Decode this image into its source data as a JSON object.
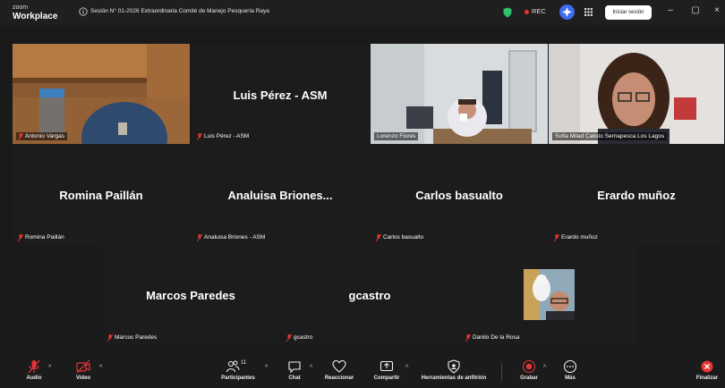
{
  "app": {
    "logo_line1": "zoom",
    "logo_line2": "Workplace"
  },
  "meeting": {
    "title": "Sesión N° 01-2026 Extraordinaria Comité de Manejo Pesquería Raya"
  },
  "topbar": {
    "rec_label": "REC",
    "signin_label": "Iniciar sesión",
    "minimize": "–",
    "restore": "▢",
    "close": "×"
  },
  "participants": [
    {
      "display": "",
      "label": "Antonio Vargas",
      "video": true,
      "muted": true
    },
    {
      "display": "Luis Pérez - ASM",
      "label": "Luis Pérez - ASM",
      "video": false,
      "muted": true
    },
    {
      "display": "",
      "label": "Lorenzo Flores",
      "video": true,
      "muted": false
    },
    {
      "display": "",
      "label": "Sofia Milad Calisto Sernapesca Los Lagos",
      "video": true,
      "muted": false,
      "speaking": true
    },
    {
      "display": "Romina Paillán",
      "label": "Romina Paillán",
      "video": false,
      "muted": true
    },
    {
      "display": "Analuisa  Briones...",
      "label": "Analuisa Briones - ASM",
      "video": false,
      "muted": true
    },
    {
      "display": "Carlos  basualto",
      "label": "Carlos  basualto",
      "video": false,
      "muted": true
    },
    {
      "display": "Erardo muñoz",
      "label": "Erardo muñoz",
      "video": false,
      "muted": true
    },
    {
      "display": "Marcos Paredes",
      "label": "Marcos Paredes",
      "video": false,
      "muted": true
    },
    {
      "display": "gcastro",
      "label": "gcastro",
      "video": false,
      "muted": true
    },
    {
      "display": "",
      "label": "Danilo De la Rosa",
      "video": false,
      "muted": true,
      "avatar": true
    }
  ],
  "toolbar": {
    "audio": "Audio",
    "video": "Video",
    "participants": "Participantes",
    "participants_count": "11",
    "chat": "Chat",
    "react": "Reaccionar",
    "share": "Compartir",
    "host_tools": "Herramientas de anfitrión",
    "record": "Grabar",
    "more": "Más",
    "end": "Finalizar"
  },
  "colors": {
    "background": "#1a1a1a",
    "speaker_outline": "#38d47a",
    "rec_red": "#e63535",
    "accent_blue": "#3d6cf0"
  }
}
